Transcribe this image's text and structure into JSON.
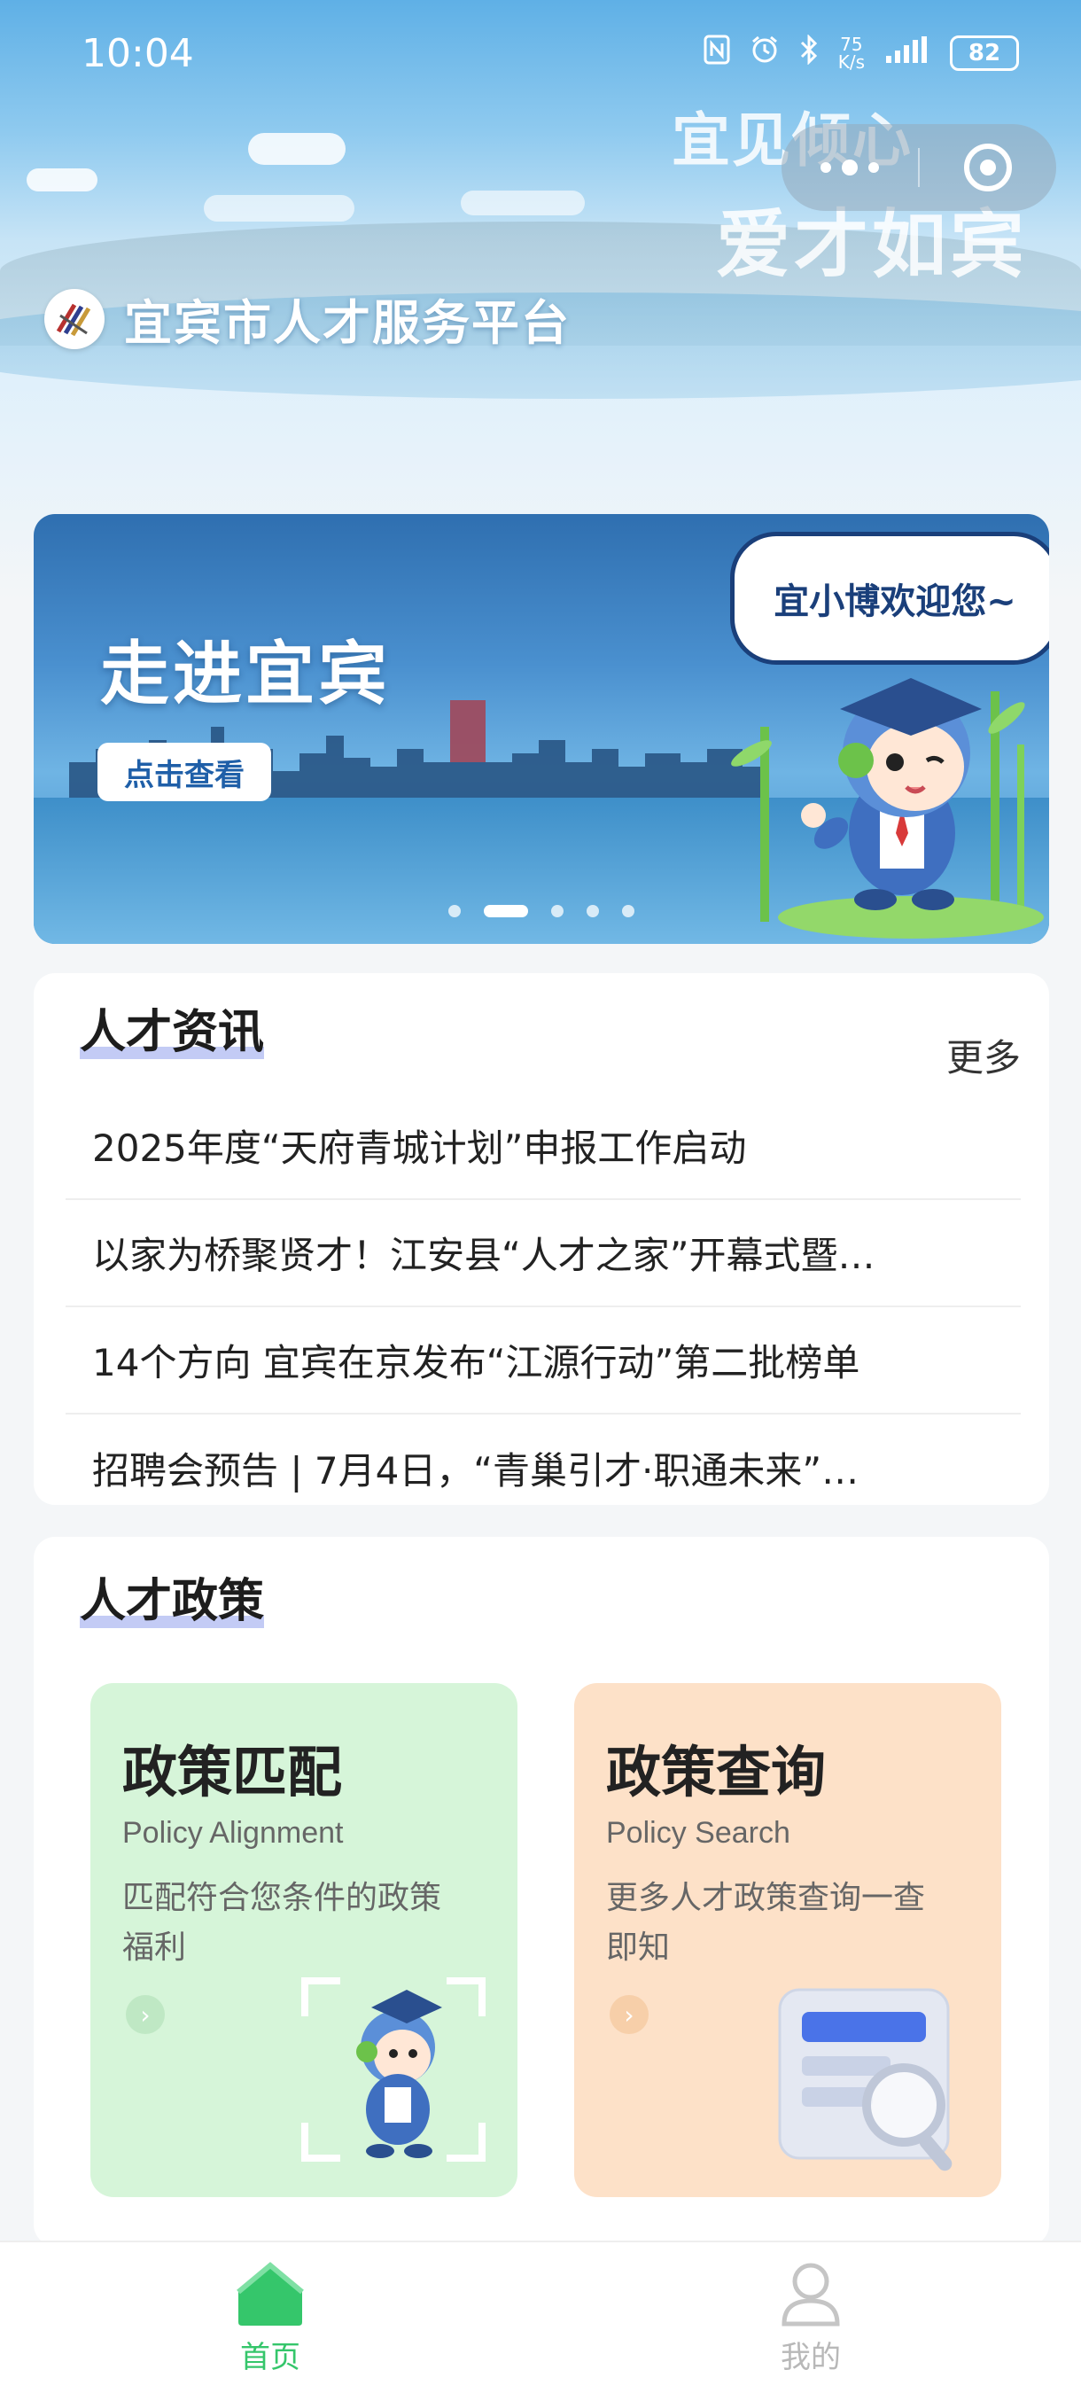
{
  "status_bar": {
    "time": "10:04",
    "speed_value": "75",
    "speed_unit": "K/s",
    "battery": "82"
  },
  "header": {
    "slogan_line1": "宜见倾心",
    "slogan_line2": "爱才如宾",
    "app_title": "宜宾市人才服务平台"
  },
  "banner": {
    "title": "走进宜宾",
    "button_label": "点击查看",
    "bubble_text": "宜小博欢迎您~",
    "slide_count": 5,
    "active_slide": 2
  },
  "news": {
    "title": "人才资讯",
    "more_label": "更多",
    "items": [
      "2025年度“天府青城计划”申报工作启动",
      "以家为桥聚贤才！江安县“人才之家”开幕式暨…",
      "14个方向 宜宾在京发布“江源行动”第二批榜单",
      "招聘会预告 | 7月4日，“青巢引才·职通未来”…"
    ]
  },
  "policy": {
    "title": "人才政策",
    "cards": [
      {
        "title": "政策匹配",
        "subtitle": "Policy Alignment",
        "desc": "匹配符合您条件的政策福利"
      },
      {
        "title": "政策查询",
        "subtitle": "Policy Search",
        "desc": "更多人才政策查询一查即知"
      }
    ]
  },
  "tabbar": {
    "items": [
      {
        "label": "首页",
        "active": true
      },
      {
        "label": "我的",
        "active": false
      }
    ]
  },
  "colors": {
    "accent_green": "#35c66b",
    "title_underline": "#c3cbf5",
    "card_green": "#d6f5d9",
    "card_orange": "#fde1c8"
  }
}
